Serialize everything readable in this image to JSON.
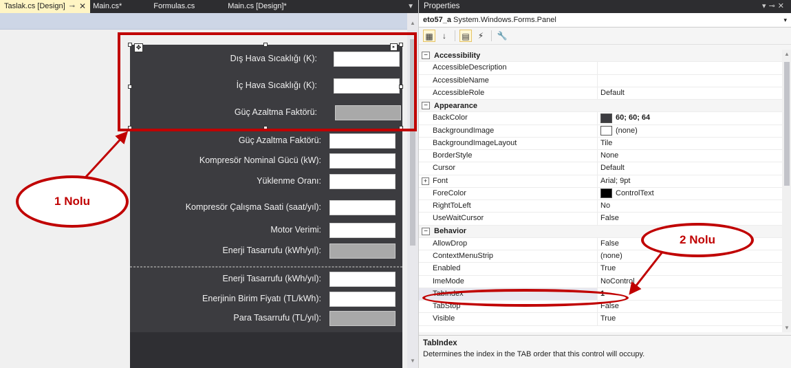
{
  "tabs": [
    {
      "label": "Taslak.cs [Design]",
      "active": true
    },
    {
      "label": "Main.cs*",
      "active": false
    },
    {
      "label": "Formulas.cs",
      "active": false
    },
    {
      "label": "Main.cs [Design]*",
      "active": false
    }
  ],
  "form": {
    "panel_a": [
      {
        "label": "Dış Hava Sıcaklığı (K):"
      },
      {
        "label": "İç Hava Sıcaklığı (K):"
      },
      {
        "label": "Güç Azaltma Faktörü:"
      }
    ],
    "panel_b": [
      {
        "label": "Güç Azaltma Faktörü:"
      },
      {
        "label": "Kompresör Nominal Gücü (kW):"
      },
      {
        "label": "Yüklenme Oranı:"
      },
      {
        "label": "Kompresör Çalışma Saati (saat/yıl):"
      },
      {
        "label": "Motor Verimi:"
      },
      {
        "label": "Enerji Tasarrufu (kWh/yıl):"
      }
    ],
    "panel_c": [
      {
        "label": "Enerji Tasarrufu (kWh/yıl):"
      },
      {
        "label": "Enerjinin Birim Fiyatı (TL/kWh):"
      },
      {
        "label": "Para Tasarrufu (TL/yıl):"
      }
    ]
  },
  "annotations": {
    "callout_1": "1 Nolu",
    "callout_2": "2 Nolu",
    "color": "#c00000"
  },
  "properties": {
    "title": "Properties",
    "object_name": "eto57_a",
    "object_type": "System.Windows.Forms.Panel",
    "categories": [
      {
        "name": "Accessibility",
        "rows": [
          {
            "name": "AccessibleDescription",
            "value": ""
          },
          {
            "name": "AccessibleName",
            "value": ""
          },
          {
            "name": "AccessibleRole",
            "value": "Default"
          }
        ]
      },
      {
        "name": "Appearance",
        "rows": [
          {
            "name": "BackColor",
            "value": "60; 60; 64",
            "swatch": "#3c3c40",
            "bold": true
          },
          {
            "name": "BackgroundImage",
            "value": "(none)",
            "swatch": "#ffffff"
          },
          {
            "name": "BackgroundImageLayout",
            "value": "Tile"
          },
          {
            "name": "BorderStyle",
            "value": "None"
          },
          {
            "name": "Cursor",
            "value": "Default"
          },
          {
            "name": "Font",
            "value": "Arial; 9pt",
            "expandable": true
          },
          {
            "name": "ForeColor",
            "value": "ControlText",
            "swatch": "#000000"
          },
          {
            "name": "RightToLeft",
            "value": "No"
          },
          {
            "name": "UseWaitCursor",
            "value": "False"
          }
        ]
      },
      {
        "name": "Behavior",
        "rows": [
          {
            "name": "AllowDrop",
            "value": "False"
          },
          {
            "name": "ContextMenuStrip",
            "value": "(none)"
          },
          {
            "name": "Enabled",
            "value": "True"
          },
          {
            "name": "ImeMode",
            "value": "NoControl"
          },
          {
            "name": "TabIndex",
            "value": "1",
            "bold": true
          },
          {
            "name": "TabStop",
            "value": "False"
          },
          {
            "name": "Visible",
            "value": "True"
          }
        ]
      }
    ],
    "description_title": "TabIndex",
    "description_text": "Determines the index in the TAB order that this control will occupy."
  }
}
